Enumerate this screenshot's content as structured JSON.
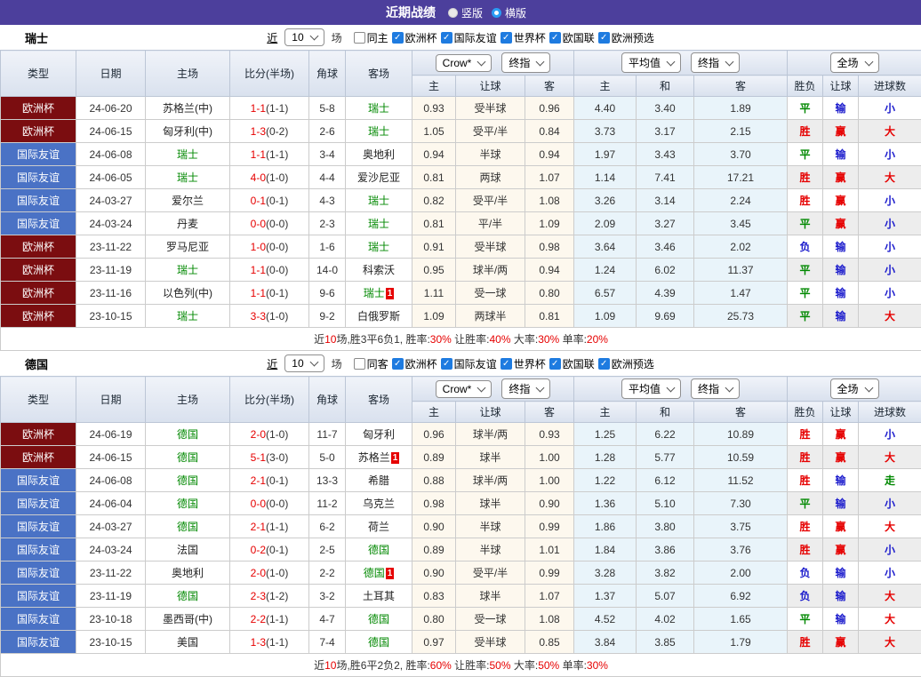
{
  "header": {
    "title": "近期战绩",
    "radio_vertical": "竖版",
    "radio_horizontal": "横版",
    "selected": "横版"
  },
  "colors": {
    "header_bar": "#4c3f9c",
    "radio_blue": "#2a9df4",
    "checkbox_blue": "#1e7be0",
    "team_focus": "#008800",
    "score_red": "#e60000",
    "crow_bg": "#fdf8ee",
    "avg_bg": "#e9f4fa",
    "stripe": "#ededed",
    "league_badges": {
      "欧洲杯": "#7b0d10",
      "国际友谊": "#4a72c5"
    }
  },
  "result_colors": {
    "胜": "#e60000",
    "平": "#008800",
    "负": "#1a1acc",
    "赢": "#e60000",
    "输": "#1a1acc",
    "走": "#008800",
    "大": "#e60000",
    "小": "#1a1acc"
  },
  "filter": {
    "prefix": "近",
    "count": "10",
    "suffix": "场",
    "leagues": [
      "欧洲杯",
      "国际友谊",
      "世界杯",
      "欧国联",
      "欧洲预选"
    ]
  },
  "table_header": {
    "left": [
      "类型",
      "日期",
      "主场",
      "比分(半场)",
      "角球",
      "客场"
    ],
    "group1": [
      "Crow*",
      "终指"
    ],
    "group2": [
      "平均值",
      "终指"
    ],
    "group3": [
      "全场"
    ],
    "sub": [
      "主",
      "让球",
      "客",
      "主",
      "和",
      "客",
      "胜负",
      "让球",
      "进球数"
    ]
  },
  "sections": [
    {
      "team": "瑞士",
      "same_label": "同主",
      "rows": [
        {
          "league": "欧洲杯",
          "date": "24-06-20",
          "home": "苏格兰(中)",
          "home_focus": false,
          "score": "1-1",
          "half": "(1-1)",
          "corners": "5-8",
          "away": "瑞士",
          "away_focus": true,
          "away_card": "",
          "crow_home": "0.93",
          "handicap": "受半球",
          "crow_away": "0.96",
          "avg_home": "4.40",
          "avg_draw": "3.40",
          "avg_away": "1.89",
          "outcome": "平",
          "handicap_result": "输",
          "goals": "小"
        },
        {
          "league": "欧洲杯",
          "date": "24-06-15",
          "home": "匈牙利(中)",
          "home_focus": false,
          "score": "1-3",
          "half": "(0-2)",
          "corners": "2-6",
          "away": "瑞士",
          "away_focus": true,
          "away_card": "",
          "crow_home": "1.05",
          "handicap": "受平/半",
          "crow_away": "0.84",
          "avg_home": "3.73",
          "avg_draw": "3.17",
          "avg_away": "2.15",
          "outcome": "胜",
          "handicap_result": "赢",
          "goals": "大"
        },
        {
          "league": "国际友谊",
          "date": "24-06-08",
          "home": "瑞士",
          "home_focus": true,
          "score": "1-1",
          "half": "(1-1)",
          "corners": "3-4",
          "away": "奥地利",
          "away_focus": false,
          "away_card": "",
          "crow_home": "0.94",
          "handicap": "半球",
          "crow_away": "0.94",
          "avg_home": "1.97",
          "avg_draw": "3.43",
          "avg_away": "3.70",
          "outcome": "平",
          "handicap_result": "输",
          "goals": "小"
        },
        {
          "league": "国际友谊",
          "date": "24-06-05",
          "home": "瑞士",
          "home_focus": true,
          "score": "4-0",
          "half": "(1-0)",
          "corners": "4-4",
          "away": "爱沙尼亚",
          "away_focus": false,
          "away_card": "",
          "crow_home": "0.81",
          "handicap": "两球",
          "crow_away": "1.07",
          "avg_home": "1.14",
          "avg_draw": "7.41",
          "avg_away": "17.21",
          "outcome": "胜",
          "handicap_result": "赢",
          "goals": "大"
        },
        {
          "league": "国际友谊",
          "date": "24-03-27",
          "home": "爱尔兰",
          "home_focus": false,
          "score": "0-1",
          "half": "(0-1)",
          "corners": "4-3",
          "away": "瑞士",
          "away_focus": true,
          "away_card": "",
          "crow_home": "0.82",
          "handicap": "受平/半",
          "crow_away": "1.08",
          "avg_home": "3.26",
          "avg_draw": "3.14",
          "avg_away": "2.24",
          "outcome": "胜",
          "handicap_result": "赢",
          "goals": "小"
        },
        {
          "league": "国际友谊",
          "date": "24-03-24",
          "home": "丹麦",
          "home_focus": false,
          "score": "0-0",
          "half": "(0-0)",
          "corners": "2-3",
          "away": "瑞士",
          "away_focus": true,
          "away_card": "",
          "crow_home": "0.81",
          "handicap": "平/半",
          "crow_away": "1.09",
          "avg_home": "2.09",
          "avg_draw": "3.27",
          "avg_away": "3.45",
          "outcome": "平",
          "handicap_result": "赢",
          "goals": "小"
        },
        {
          "league": "欧洲杯",
          "date": "23-11-22",
          "home": "罗马尼亚",
          "home_focus": false,
          "score": "1-0",
          "half": "(0-0)",
          "corners": "1-6",
          "away": "瑞士",
          "away_focus": true,
          "away_card": "",
          "crow_home": "0.91",
          "handicap": "受半球",
          "crow_away": "0.98",
          "avg_home": "3.64",
          "avg_draw": "3.46",
          "avg_away": "2.02",
          "outcome": "负",
          "handicap_result": "输",
          "goals": "小"
        },
        {
          "league": "欧洲杯",
          "date": "23-11-19",
          "home": "瑞士",
          "home_focus": true,
          "score": "1-1",
          "half": "(0-0)",
          "corners": "14-0",
          "away": "科索沃",
          "away_focus": false,
          "away_card": "",
          "crow_home": "0.95",
          "handicap": "球半/两",
          "crow_away": "0.94",
          "avg_home": "1.24",
          "avg_draw": "6.02",
          "avg_away": "11.37",
          "outcome": "平",
          "handicap_result": "输",
          "goals": "小"
        },
        {
          "league": "欧洲杯",
          "date": "23-11-16",
          "home": "以色列(中)",
          "home_focus": false,
          "score": "1-1",
          "half": "(0-1)",
          "corners": "9-6",
          "away": "瑞士",
          "away_focus": true,
          "away_card": "1",
          "crow_home": "1.11",
          "handicap": "受一球",
          "crow_away": "0.80",
          "avg_home": "6.57",
          "avg_draw": "4.39",
          "avg_away": "1.47",
          "outcome": "平",
          "handicap_result": "输",
          "goals": "小"
        },
        {
          "league": "欧洲杯",
          "date": "23-10-15",
          "home": "瑞士",
          "home_focus": true,
          "score": "3-3",
          "half": "(1-0)",
          "corners": "9-2",
          "away": "白俄罗斯",
          "away_focus": false,
          "away_card": "",
          "crow_home": "1.09",
          "handicap": "两球半",
          "crow_away": "0.81",
          "avg_home": "1.09",
          "avg_draw": "9.69",
          "avg_away": "25.73",
          "outcome": "平",
          "handicap_result": "输",
          "goals": "大"
        }
      ],
      "summary": [
        {
          "text": "近",
          "red": false
        },
        {
          "text": "10",
          "red": true
        },
        {
          "text": "场,胜3平6负1, 胜率:",
          "red": false
        },
        {
          "text": "30%",
          "red": true
        },
        {
          "text": " 让胜率:",
          "red": false
        },
        {
          "text": "40%",
          "red": true
        },
        {
          "text": " 大率:",
          "red": false
        },
        {
          "text": "30%",
          "red": true
        },
        {
          "text": " 单率:",
          "red": false
        },
        {
          "text": "20%",
          "red": true
        }
      ]
    },
    {
      "team": "德国",
      "same_label": "同客",
      "rows": [
        {
          "league": "欧洲杯",
          "date": "24-06-19",
          "home": "德国",
          "home_focus": true,
          "score": "2-0",
          "half": "(1-0)",
          "corners": "11-7",
          "away": "匈牙利",
          "away_focus": false,
          "away_card": "",
          "crow_home": "0.96",
          "handicap": "球半/两",
          "crow_away": "0.93",
          "avg_home": "1.25",
          "avg_draw": "6.22",
          "avg_away": "10.89",
          "outcome": "胜",
          "handicap_result": "赢",
          "goals": "小"
        },
        {
          "league": "欧洲杯",
          "date": "24-06-15",
          "home": "德国",
          "home_focus": true,
          "score": "5-1",
          "half": "(3-0)",
          "corners": "5-0",
          "away": "苏格兰",
          "away_focus": false,
          "away_card": "1",
          "crow_home": "0.89",
          "handicap": "球半",
          "crow_away": "1.00",
          "avg_home": "1.28",
          "avg_draw": "5.77",
          "avg_away": "10.59",
          "outcome": "胜",
          "handicap_result": "赢",
          "goals": "大"
        },
        {
          "league": "国际友谊",
          "date": "24-06-08",
          "home": "德国",
          "home_focus": true,
          "score": "2-1",
          "half": "(0-1)",
          "corners": "13-3",
          "away": "希腊",
          "away_focus": false,
          "away_card": "",
          "crow_home": "0.88",
          "handicap": "球半/两",
          "crow_away": "1.00",
          "avg_home": "1.22",
          "avg_draw": "6.12",
          "avg_away": "11.52",
          "outcome": "胜",
          "handicap_result": "输",
          "goals": "走"
        },
        {
          "league": "国际友谊",
          "date": "24-06-04",
          "home": "德国",
          "home_focus": true,
          "score": "0-0",
          "half": "(0-0)",
          "corners": "11-2",
          "away": "乌克兰",
          "away_focus": false,
          "away_card": "",
          "crow_home": "0.98",
          "handicap": "球半",
          "crow_away": "0.90",
          "avg_home": "1.36",
          "avg_draw": "5.10",
          "avg_away": "7.30",
          "outcome": "平",
          "handicap_result": "输",
          "goals": "小"
        },
        {
          "league": "国际友谊",
          "date": "24-03-27",
          "home": "德国",
          "home_focus": true,
          "score": "2-1",
          "half": "(1-1)",
          "corners": "6-2",
          "away": "荷兰",
          "away_focus": false,
          "away_card": "",
          "crow_home": "0.90",
          "handicap": "半球",
          "crow_away": "0.99",
          "avg_home": "1.86",
          "avg_draw": "3.80",
          "avg_away": "3.75",
          "outcome": "胜",
          "handicap_result": "赢",
          "goals": "大"
        },
        {
          "league": "国际友谊",
          "date": "24-03-24",
          "home": "法国",
          "home_focus": false,
          "score": "0-2",
          "half": "(0-1)",
          "corners": "2-5",
          "away": "德国",
          "away_focus": true,
          "away_card": "",
          "crow_home": "0.89",
          "handicap": "半球",
          "crow_away": "1.01",
          "avg_home": "1.84",
          "avg_draw": "3.86",
          "avg_away": "3.76",
          "outcome": "胜",
          "handicap_result": "赢",
          "goals": "小"
        },
        {
          "league": "国际友谊",
          "date": "23-11-22",
          "home": "奥地利",
          "home_focus": false,
          "score": "2-0",
          "half": "(1-0)",
          "corners": "2-2",
          "away": "德国",
          "away_focus": true,
          "away_card": "1",
          "crow_home": "0.90",
          "handicap": "受平/半",
          "crow_away": "0.99",
          "avg_home": "3.28",
          "avg_draw": "3.82",
          "avg_away": "2.00",
          "outcome": "负",
          "handicap_result": "输",
          "goals": "小"
        },
        {
          "league": "国际友谊",
          "date": "23-11-19",
          "home": "德国",
          "home_focus": true,
          "score": "2-3",
          "half": "(1-2)",
          "corners": "3-2",
          "away": "土耳其",
          "away_focus": false,
          "away_card": "",
          "crow_home": "0.83",
          "handicap": "球半",
          "crow_away": "1.07",
          "avg_home": "1.37",
          "avg_draw": "5.07",
          "avg_away": "6.92",
          "outcome": "负",
          "handicap_result": "输",
          "goals": "大"
        },
        {
          "league": "国际友谊",
          "date": "23-10-18",
          "home": "墨西哥(中)",
          "home_focus": false,
          "score": "2-2",
          "half": "(1-1)",
          "corners": "4-7",
          "away": "德国",
          "away_focus": true,
          "away_card": "",
          "crow_home": "0.80",
          "handicap": "受一球",
          "crow_away": "1.08",
          "avg_home": "4.52",
          "avg_draw": "4.02",
          "avg_away": "1.65",
          "outcome": "平",
          "handicap_result": "输",
          "goals": "大"
        },
        {
          "league": "国际友谊",
          "date": "23-10-15",
          "home": "美国",
          "home_focus": false,
          "score": "1-3",
          "half": "(1-1)",
          "corners": "7-4",
          "away": "德国",
          "away_focus": true,
          "away_card": "",
          "crow_home": "0.97",
          "handicap": "受半球",
          "crow_away": "0.85",
          "avg_home": "3.84",
          "avg_draw": "3.85",
          "avg_away": "1.79",
          "outcome": "胜",
          "handicap_result": "赢",
          "goals": "大"
        }
      ],
      "summary": [
        {
          "text": "近",
          "red": false
        },
        {
          "text": "10",
          "red": true
        },
        {
          "text": "场,胜6平2负2, 胜率:",
          "red": false
        },
        {
          "text": "60%",
          "red": true
        },
        {
          "text": " 让胜率:",
          "red": false
        },
        {
          "text": "50%",
          "red": true
        },
        {
          "text": " 大率:",
          "red": false
        },
        {
          "text": "50%",
          "red": true
        },
        {
          "text": " 单率:",
          "red": false
        },
        {
          "text": "30%",
          "red": true
        }
      ]
    }
  ]
}
